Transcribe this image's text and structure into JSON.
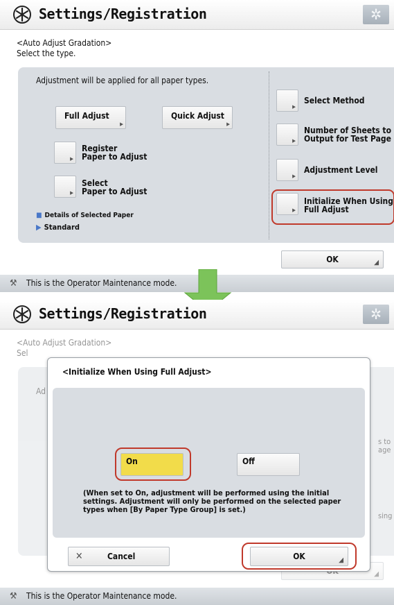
{
  "colors": {
    "accent_ring": "#c0392b",
    "selected_option": "#f2dc4a",
    "arrow": "#7cc35a",
    "panel_gray": "#d9dde2"
  },
  "top": {
    "header": {
      "title": "Settings/Registration",
      "icon": "settings-registration-icon",
      "gear": "gear-icon"
    },
    "breadcrumb": {
      "line1": "<Auto Adjust Gradation>",
      "line2": "Select the type."
    },
    "note": "Adjustment will be applied for all paper types.",
    "buttons": {
      "full_adjust": "Full Adjust",
      "quick_adjust": "Quick Adjust",
      "register_line1": "Register",
      "register_line2": "Paper to Adjust",
      "select_line1": "Select",
      "select_line2": "Paper to Adjust"
    },
    "details": {
      "label": "Details of Selected Paper",
      "value": "Standard"
    },
    "side": {
      "select_method": "Select Method",
      "sheets_line1": "Number of Sheets to",
      "sheets_line2": "Output for Test Page",
      "adjustment_level": "Adjustment Level",
      "initialize_line1": "Initialize When Using",
      "initialize_line2": "Full Adjust"
    },
    "ok": "OK",
    "status": "This is the Operator Maintenance mode."
  },
  "bottom": {
    "header": {
      "title": "Settings/Registration"
    },
    "bg": {
      "crumb1": "<Auto Adjust Gradation>",
      "crumb2": "Sel",
      "note": "Ad",
      "side1": "s to",
      "side2": "age",
      "side3": "sing",
      "ok": "OK"
    },
    "dialog": {
      "title": "<Initialize When Using Full Adjust>",
      "on": "On",
      "off": "Off",
      "note": "(When set to On, adjustment will be performed using the initial settings. Adjustment will only be performed on the selected paper types when [By Paper Type Group] is set.)",
      "cancel": "Cancel",
      "ok": "OK"
    },
    "status": "This is the Operator Maintenance mode."
  }
}
